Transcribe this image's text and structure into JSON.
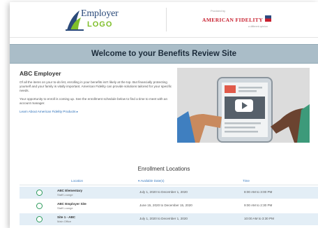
{
  "header": {
    "employer_logo_top": "Employer",
    "employer_logo_bottom": "LOGO",
    "af_prefix": "Provided by",
    "af_name": "AMERICAN FIDELITY",
    "af_tagline": "a different opinion"
  },
  "banner": {
    "title": "Welcome to your Benefits Review Site"
  },
  "intro": {
    "heading": "ABC Employer",
    "paragraph1": "Of all the items on your to-do list, enrolling in your benefits isn't likely at the top. But financially protecting yourself and your family is vitally important. American Fidelity can provide solutions tailored for your specific needs.",
    "paragraph2": "Your opportunity to enroll is coming up. See the enrollment schedule below to find a time to meet with an account manager.",
    "link": "Learn About American Fidelity Products ▸"
  },
  "enrollment": {
    "title": "Enrollment Locations",
    "columns": {
      "location": "Location",
      "dates": "▾  Available Date(s)",
      "time": "Time"
    },
    "rows": [
      {
        "name": "ABC Elementary",
        "sub": "Staff Lounge",
        "dates": "July 1, 2020 to December 1, 2020",
        "time": "8:00 AM to 3:00 PM"
      },
      {
        "name": "ABC Employer Site",
        "sub": "Staff Lounge",
        "dates": "June 15, 2020 to December 15, 2020",
        "time": "9:00 AM to 2:30 PM"
      },
      {
        "name": "Site 1 - ABC",
        "sub": "Main Office",
        "dates": "July 1, 2020 to December 1, 2020",
        "time": "10:00 AM to 3:30 PM"
      }
    ]
  },
  "colors": {
    "banner": "#aabdc8",
    "accent_green": "#2c9a5c",
    "link_blue": "#2b6fb8",
    "af_red": "#c8202f"
  },
  "icons": {
    "video": "play-icon"
  }
}
